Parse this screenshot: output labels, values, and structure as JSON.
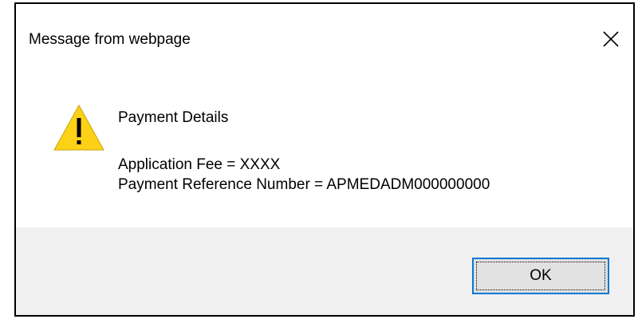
{
  "dialog": {
    "title": "Message from webpage",
    "close_icon": "close-icon",
    "warning_icon": "warning-icon",
    "heading": "Payment Details",
    "fee_line": "Application Fee = XXXX",
    "reference_line": "Payment Reference Number = APMEDADM000000000",
    "ok_label": "OK"
  },
  "colors": {
    "accent": "#0078d7",
    "footer_bg": "#f0f0f0",
    "warning_fill": "#fcd116"
  }
}
